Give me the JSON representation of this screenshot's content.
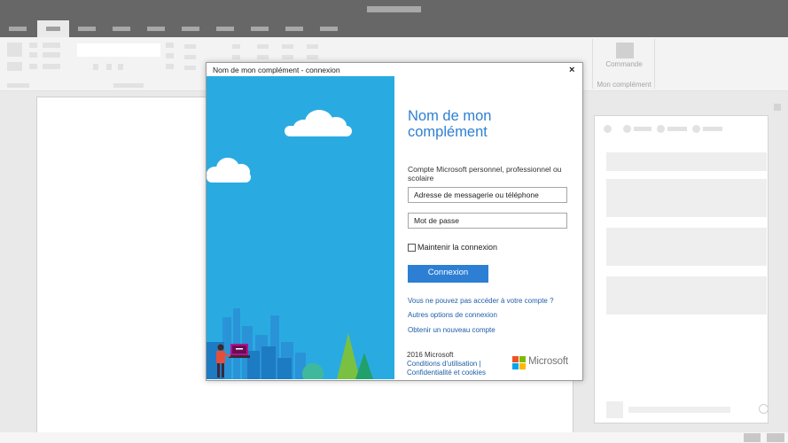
{
  "dialog": {
    "window_title": "Nom de mon complément - connexion",
    "close_glyph": "×",
    "heading": "Nom de mon complément",
    "account_prompt": "Compte Microsoft personnel, professionnel ou scolaire",
    "email_placeholder": "Adresse de messagerie ou téléphone",
    "password_placeholder": "Mot de passe",
    "remember_label": "Maintenir la connexion",
    "signin_label": "Connexion",
    "links": [
      "Vous ne pouvez pas accéder à votre compte ?",
      "Autres options de connexion",
      "Obtenir un nouveau compte"
    ],
    "footer": {
      "year": "2016 Microsoft",
      "terms": "Conditions d'utilisation |",
      "privacy": "Confidentialité et cookies",
      "brand": "Microsoft"
    }
  },
  "ribbon": {
    "command_label": "Commande",
    "group_label": "Mon complément"
  },
  "colors": {
    "accent": "#2d7fd3",
    "illustration_bg": "#29abe2",
    "chrome": "#676767",
    "ms_red": "#f25022",
    "ms_green": "#7fba00",
    "ms_blue": "#00a4ef",
    "ms_yellow": "#ffb900"
  },
  "icons": {
    "close": "close-icon",
    "checkbox": "checkbox-icon",
    "logo": "microsoft-logo-icon"
  }
}
